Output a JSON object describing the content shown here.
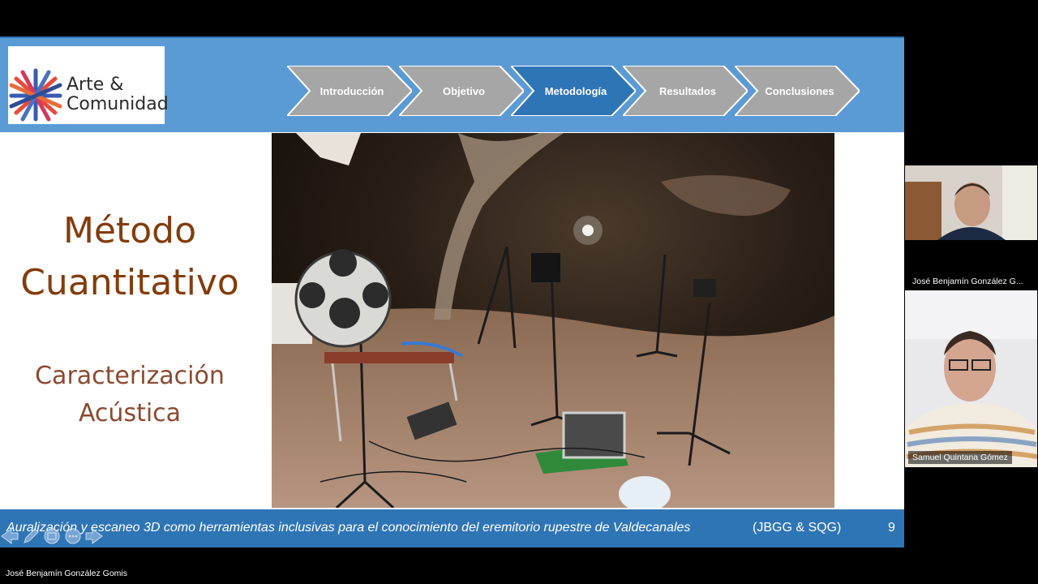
{
  "logo": {
    "line1": "Arte &",
    "line2": "Comunidad"
  },
  "nav": {
    "items": [
      {
        "label": "Introducción",
        "active": false
      },
      {
        "label": "Objetivo",
        "active": false
      },
      {
        "label": "Metodología",
        "active": true
      },
      {
        "label": "Resultados",
        "active": false
      },
      {
        "label": "Conclusiones",
        "active": false
      }
    ]
  },
  "title": {
    "main_line1": "Método",
    "main_line2": "Cuantitativo",
    "sub_line1": "Caracterización",
    "sub_line2": "Acústica"
  },
  "footer": {
    "title": "Auralización y escaneo 3D como herramientas inclusivas para el conocimiento del eremitorio rupestre de Valdecanales",
    "authors": "(JBGG & SQG)",
    "page": "9"
  },
  "participants": [
    {
      "name": "José Benjamín González G..."
    },
    {
      "name": "Samuel Quintana Gómez"
    }
  ],
  "presenter_label": "José Benjamín González Gomis",
  "colors": {
    "header_bg": "#5b9bd5",
    "nav_inactive": "#a6a6a6",
    "nav_active": "#2e75b6",
    "title_text": "#843c0c",
    "footer_bg": "#2e75b6"
  }
}
